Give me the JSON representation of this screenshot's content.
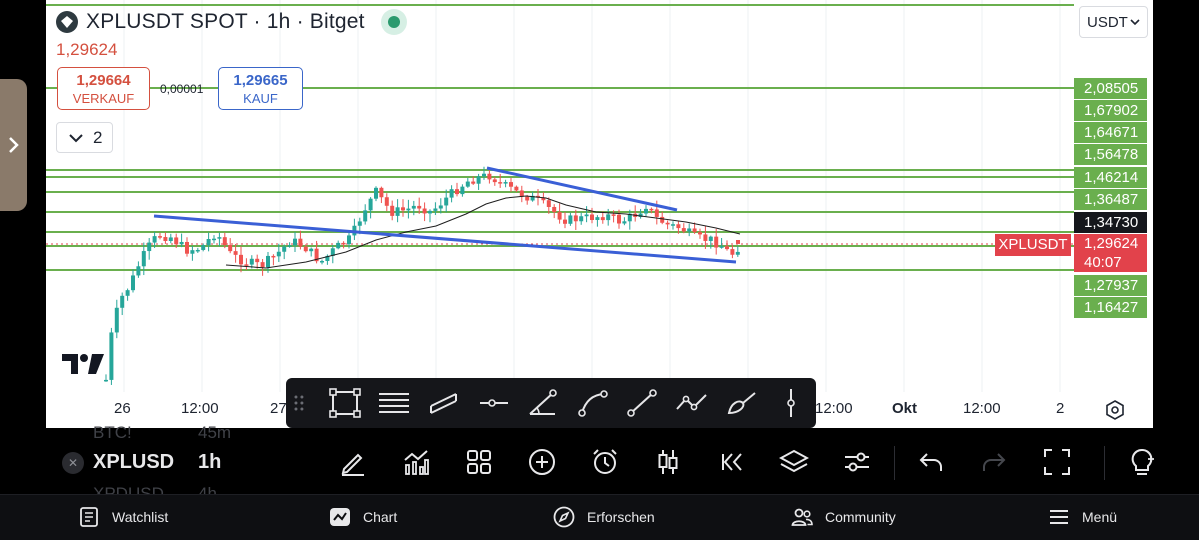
{
  "header": {
    "title": "XPLUSDT SPOT · 1h · Bitget",
    "last_price": "1,29624",
    "status_color": "#2b9a6e"
  },
  "quote": {
    "sell_value": "1,29664",
    "sell_label": "VERKAUF",
    "spread": "0,00001",
    "buy_value": "1,29665",
    "buy_label": "KAUF"
  },
  "indicators_toggle": {
    "count": "2"
  },
  "currency": {
    "selected": "USDT"
  },
  "price_scale": {
    "levels": [
      "2,08505",
      "1,67902",
      "1,64671",
      "1,56478",
      "1,46214",
      "1,36487"
    ],
    "current_ma": "1,34730",
    "symbol_tag": "XPLUSDT",
    "current_price": "1,29624",
    "countdown": "40:07",
    "lower_levels": [
      "1,27937",
      "1,16427"
    ]
  },
  "time_axis": {
    "labels": [
      "26",
      "12:00",
      "27",
      "12:00",
      "Okt",
      "12:00",
      "2"
    ]
  },
  "colors": {
    "up": "#26a69a",
    "down": "#ef5350",
    "level_line": "#6aaf4e",
    "trend_line": "#3a5fd6",
    "ma_line": "#1e1e1e"
  },
  "drawing_tools": [
    {
      "name": "rectangle-tool-icon"
    },
    {
      "name": "fib-retracement-icon"
    },
    {
      "name": "parallel-channel-icon"
    },
    {
      "name": "horizontal-ray-icon"
    },
    {
      "name": "trend-angle-icon"
    },
    {
      "name": "curve-tool-icon"
    },
    {
      "name": "trend-line-icon"
    },
    {
      "name": "path-tool-icon"
    },
    {
      "name": "brush-tool-icon"
    },
    {
      "name": "vertical-line-icon"
    }
  ],
  "toolbar": {
    "symbol": "XPLUSD",
    "interval": "1h",
    "ghost_above_symbol": "BTC!",
    "ghost_above_interval": "45m",
    "ghost_below_symbol": "XPDUSD",
    "ghost_below_interval": "4h"
  },
  "bottom_nav": {
    "watchlist": "Watchlist",
    "chart": "Chart",
    "explore": "Erforschen",
    "community": "Community",
    "menu": "Menü"
  }
}
